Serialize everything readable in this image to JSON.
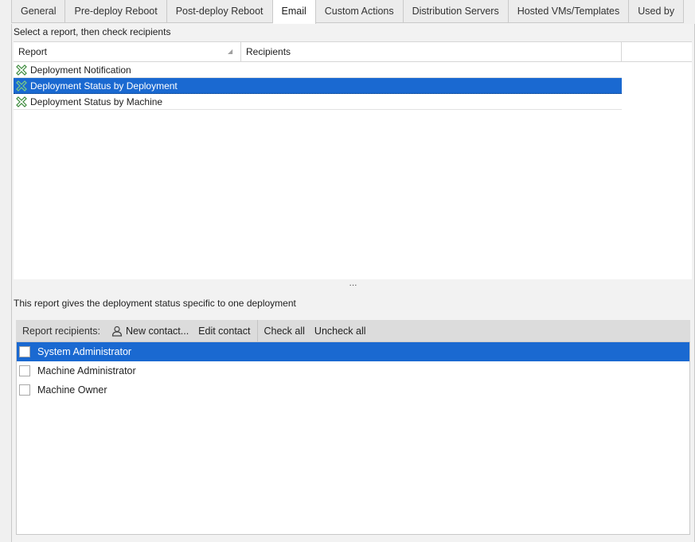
{
  "tabs": [
    {
      "label": "General"
    },
    {
      "label": "Pre-deploy Reboot"
    },
    {
      "label": "Post-deploy Reboot"
    },
    {
      "label": "Email",
      "active": true
    },
    {
      "label": "Custom Actions"
    },
    {
      "label": "Distribution Servers"
    },
    {
      "label": "Hosted VMs/Templates"
    },
    {
      "label": "Used by"
    }
  ],
  "hint": "Select a report, then check recipients",
  "report_grid": {
    "columns": [
      "Report",
      "Recipients"
    ],
    "rows": [
      {
        "name": "Deployment Notification",
        "recipients": "",
        "selected": false,
        "icon": "report-icon"
      },
      {
        "name": "Deployment Status by Deployment",
        "recipients": "",
        "selected": true,
        "icon": "report-icon"
      },
      {
        "name": "Deployment Status by Machine",
        "recipients": "",
        "selected": false,
        "icon": "report-icon"
      }
    ]
  },
  "splitter": "...",
  "description": "This report gives the deployment status specific to one deployment",
  "toolbar": {
    "label": "Report recipients:",
    "new_contact": "New contact...",
    "edit_contact": "Edit contact",
    "check_all": "Check all",
    "uncheck_all": "Uncheck all"
  },
  "recipients": [
    {
      "name": "System Administrator",
      "checked": false,
      "selected": true
    },
    {
      "name": "Machine Administrator",
      "checked": false,
      "selected": false
    },
    {
      "name": "Machine Owner",
      "checked": false,
      "selected": false
    }
  ],
  "colors": {
    "selection": "#1a69d1",
    "toolbar": "#dcdcdc",
    "icon_green": "#3a8a3a"
  }
}
